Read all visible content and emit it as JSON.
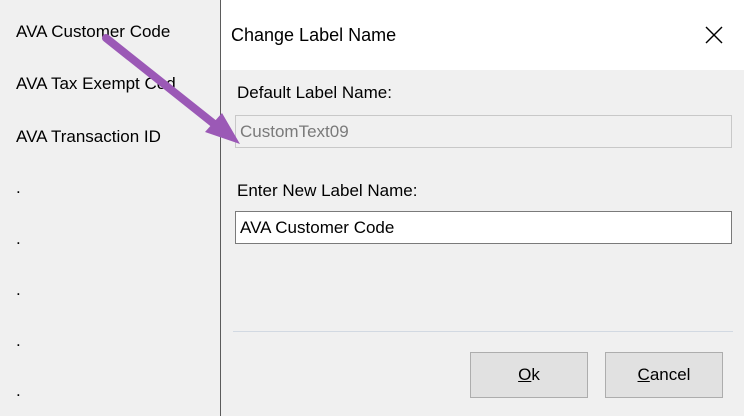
{
  "background_list": {
    "items": [
      "AVA Customer Code",
      "AVA Tax Exempt Cod",
      "AVA Transaction ID"
    ],
    "placeholders": [
      ".",
      ".",
      ".",
      ".",
      "."
    ]
  },
  "dialog": {
    "title": "Change Label Name",
    "close_glyph": "✕",
    "default_label": "Default Label Name:",
    "default_value": "CustomText09",
    "new_label": "Enter New Label Name:",
    "new_value": "AVA Customer Code",
    "ok_mnemonic": "O",
    "ok_rest": "k",
    "cancel_mnemonic": "C",
    "cancel_rest": "ancel"
  },
  "annotation": {
    "arrow_color": "#9b59b6"
  }
}
